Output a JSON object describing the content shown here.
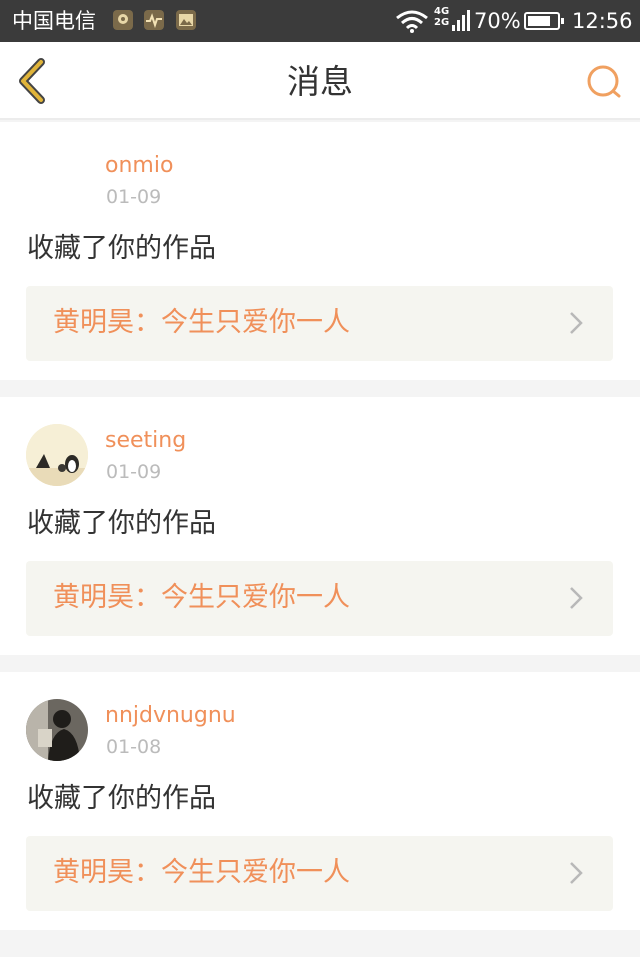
{
  "status_bar": {
    "carrier": "中国电信",
    "network": "4G 2G",
    "battery": "70%",
    "time": "12:56"
  },
  "header": {
    "title": "消息",
    "back_icon": "chevron-left-icon",
    "search_icon": "search-icon"
  },
  "colors": {
    "accent": "#f0905a",
    "back_icon": "#e0b43a",
    "text": "#333333",
    "muted": "#bbbbbb",
    "card_link_bg": "#f5f5f0"
  },
  "messages": [
    {
      "username": "onmio",
      "date": "01-09",
      "action": "收藏了你的作品",
      "work": "黄明昊：今生只爱你一人"
    },
    {
      "username": "seeting",
      "date": "01-09",
      "action": "收藏了你的作品",
      "work": "黄明昊：今生只爱你一人"
    },
    {
      "username": "nnjdvnugnu",
      "date": "01-08",
      "action": "收藏了你的作品",
      "work": "黄明昊：今生只爱你一人"
    }
  ]
}
